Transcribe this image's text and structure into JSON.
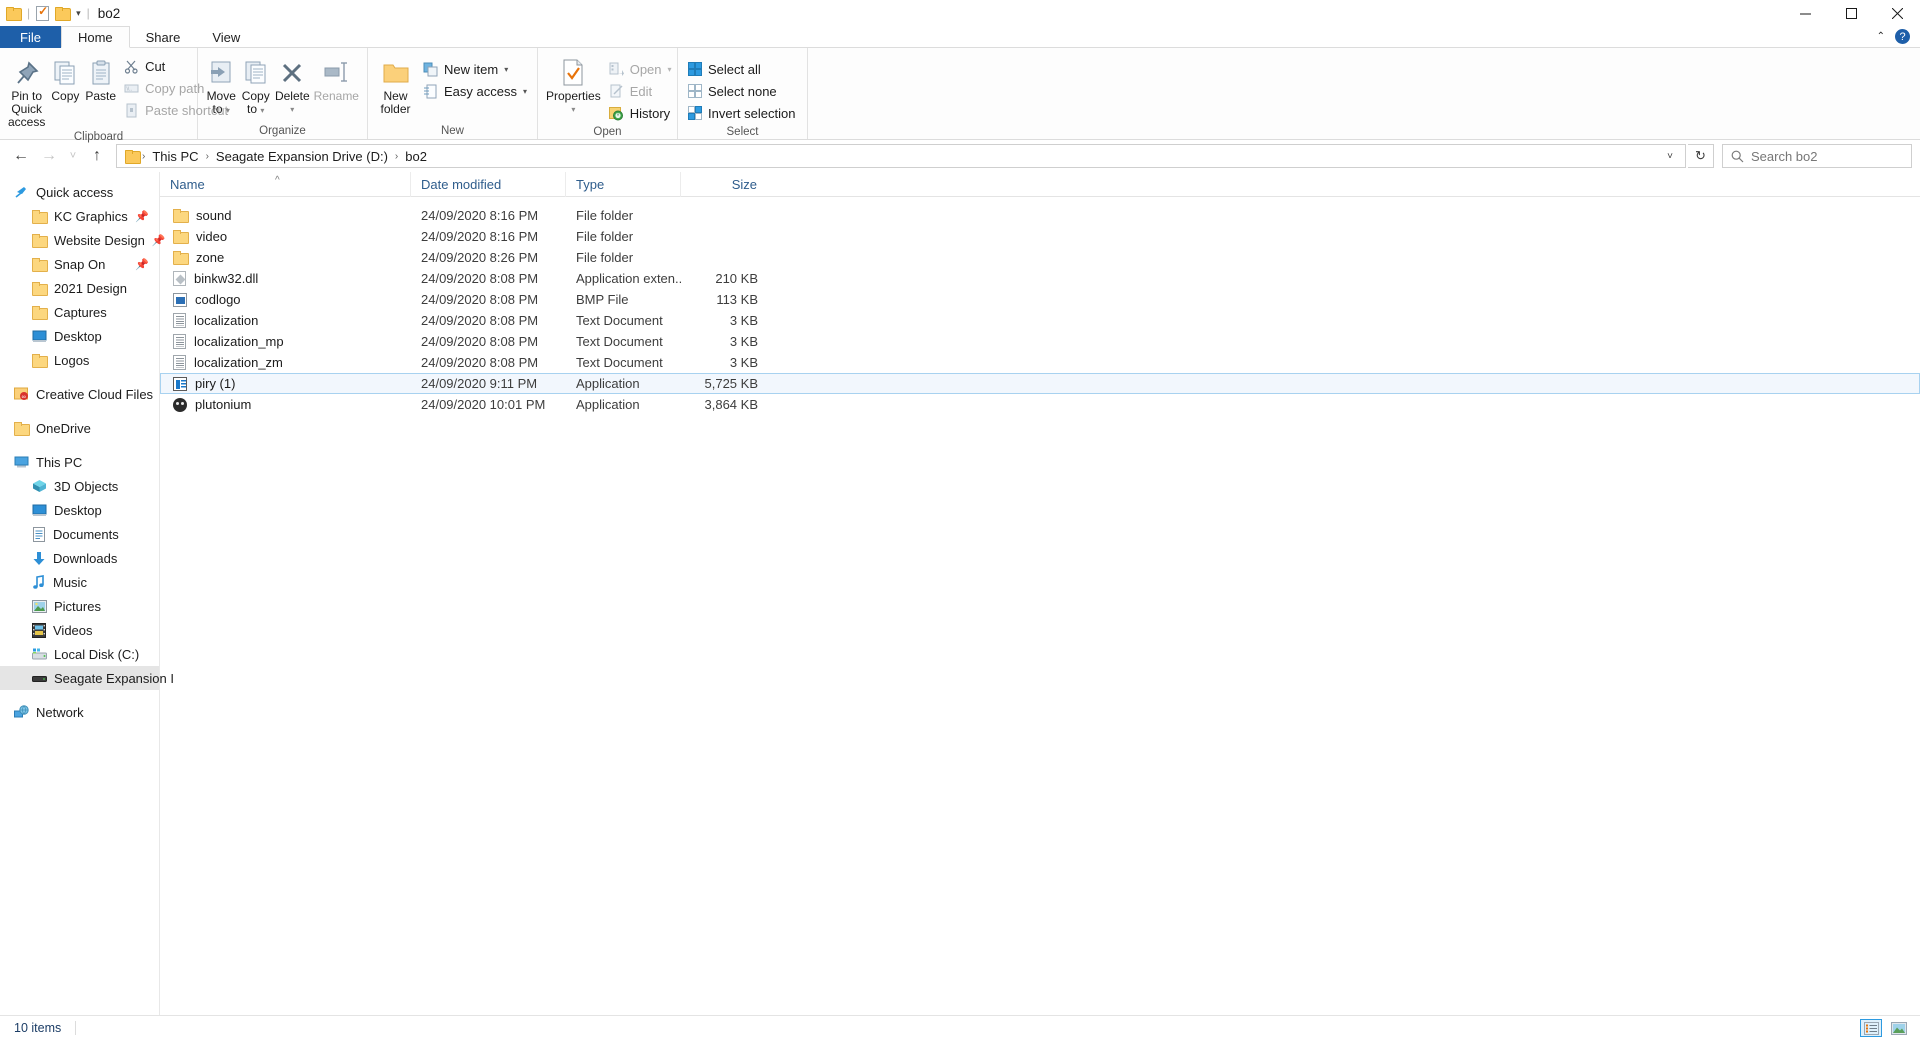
{
  "window": {
    "title": "bo2",
    "qat": [
      {
        "name": "qat-folder-icon",
        "icon": "folder-icon"
      },
      {
        "name": "qat-properties-icon",
        "icon": "properties-icon"
      },
      {
        "name": "qat-new-folder-icon",
        "icon": "folder-icon"
      }
    ],
    "buttons": {
      "minimize": "─",
      "maximize": "☐",
      "close": "✕"
    }
  },
  "tabs": [
    {
      "label": "File",
      "id": "file"
    },
    {
      "label": "Home",
      "id": "home"
    },
    {
      "label": "Share",
      "id": "share"
    },
    {
      "label": "View",
      "id": "view"
    }
  ],
  "tab_right": {
    "collapse": "⌃",
    "help": "?"
  },
  "ribbon": {
    "groups": [
      {
        "label": "Clipboard",
        "big": [
          {
            "label_line1": "Pin to Quick",
            "label_line2": "access",
            "icon": "pin-icon"
          },
          {
            "label_line1": "Copy",
            "label_line2": "",
            "icon": "copy-icon"
          },
          {
            "label_line1": "Paste",
            "label_line2": "",
            "icon": "paste-icon"
          }
        ],
        "small": [
          {
            "label": "Cut",
            "icon": "scissors-icon",
            "disabled": false
          },
          {
            "label": "Copy path",
            "icon": "copy-path-icon",
            "disabled": true
          },
          {
            "label": "Paste shortcut",
            "icon": "paste-shortcut-icon",
            "disabled": true
          }
        ]
      },
      {
        "label": "Organize",
        "big": [
          {
            "label_line1": "Move",
            "label_line2": "to",
            "icon": "move-to-icon",
            "dropdown": true
          },
          {
            "label_line1": "Copy",
            "label_line2": "to",
            "icon": "copy-to-icon",
            "dropdown": true
          },
          {
            "label_line1": "Delete",
            "label_line2": "",
            "icon": "delete-icon",
            "dropdown": true
          },
          {
            "label_line1": "Rename",
            "label_line2": "",
            "icon": "rename-icon"
          }
        ],
        "small": []
      },
      {
        "label": "New",
        "big": [
          {
            "label_line1": "New",
            "label_line2": "folder",
            "icon": "new-folder-icon"
          }
        ],
        "small": [
          {
            "label": "New item",
            "icon": "new-item-icon",
            "dropdown": true,
            "disabled": false
          },
          {
            "label": "Easy access",
            "icon": "easy-access-icon",
            "dropdown": true,
            "disabled": false
          }
        ]
      },
      {
        "label": "Open",
        "big": [
          {
            "label_line1": "Properties",
            "label_line2": "",
            "icon": "properties-icon",
            "dropdown": true
          }
        ],
        "small": [
          {
            "label": "Open",
            "icon": "open-icon",
            "dropdown": true,
            "disabled": true
          },
          {
            "label": "Edit",
            "icon": "edit-icon",
            "disabled": true
          },
          {
            "label": "History",
            "icon": "history-icon",
            "disabled": false
          }
        ]
      },
      {
        "label": "Select",
        "big": [],
        "small": [
          {
            "label": "Select all",
            "icon": "select-all-icon",
            "disabled": false
          },
          {
            "label": "Select none",
            "icon": "select-none-icon",
            "disabled": false
          },
          {
            "label": "Invert selection",
            "icon": "invert-selection-icon",
            "disabled": false
          }
        ]
      }
    ]
  },
  "addressbar": {
    "back": "←",
    "forward": "→",
    "recent": "˅",
    "up": "↑",
    "breadcrumbs": [
      "This PC",
      "Seagate Expansion Drive (D:)",
      "bo2"
    ],
    "separator": "›",
    "dropdown": "˅",
    "refresh": "↻",
    "search_placeholder": "Search bo2",
    "search_value": ""
  },
  "navpane": [
    {
      "label": "Quick access",
      "icon": "star-pin-icon",
      "level": "root",
      "pinned": false,
      "selected": false
    },
    {
      "label": "KC Graphics",
      "icon": "folder-icon",
      "level": "child",
      "pinned": true,
      "selected": false
    },
    {
      "label": "Website Design",
      "icon": "folder-icon",
      "level": "child",
      "pinned": true,
      "selected": false
    },
    {
      "label": "Snap On",
      "icon": "folder-icon",
      "level": "child",
      "pinned": true,
      "selected": false
    },
    {
      "label": "2021 Design",
      "icon": "folder-icon",
      "level": "child",
      "pinned": false,
      "selected": false
    },
    {
      "label": "Captures",
      "icon": "folder-icon",
      "level": "child",
      "pinned": false,
      "selected": false
    },
    {
      "label": "Desktop",
      "icon": "desktop-icon",
      "level": "child",
      "pinned": false,
      "selected": false
    },
    {
      "label": "Logos",
      "icon": "folder-icon",
      "level": "child",
      "pinned": false,
      "selected": false
    },
    {
      "label": "Creative Cloud Files",
      "icon": "creative-cloud-icon",
      "level": "root",
      "pinned": false,
      "selected": false,
      "spacer_before": true
    },
    {
      "label": "OneDrive",
      "icon": "onedrive-folder-icon",
      "level": "root",
      "pinned": false,
      "selected": false,
      "spacer_before": true
    },
    {
      "label": "This PC",
      "icon": "this-pc-icon",
      "level": "root",
      "pinned": false,
      "selected": false,
      "spacer_before": true
    },
    {
      "label": "3D Objects",
      "icon": "3d-objects-icon",
      "level": "child",
      "pinned": false,
      "selected": false
    },
    {
      "label": "Desktop",
      "icon": "desktop-icon",
      "level": "child",
      "pinned": false,
      "selected": false
    },
    {
      "label": "Documents",
      "icon": "documents-icon",
      "level": "child",
      "pinned": false,
      "selected": false
    },
    {
      "label": "Downloads",
      "icon": "downloads-icon",
      "level": "child",
      "pinned": false,
      "selected": false
    },
    {
      "label": "Music",
      "icon": "music-icon",
      "level": "child",
      "pinned": false,
      "selected": false
    },
    {
      "label": "Pictures",
      "icon": "pictures-icon",
      "level": "child",
      "pinned": false,
      "selected": false
    },
    {
      "label": "Videos",
      "icon": "videos-icon",
      "level": "child",
      "pinned": false,
      "selected": false
    },
    {
      "label": "Local Disk (C:)",
      "icon": "drive-icon",
      "level": "child",
      "pinned": false,
      "selected": false
    },
    {
      "label": "Seagate Expansion I",
      "icon": "external-drive-icon",
      "level": "child",
      "pinned": false,
      "selected": true
    },
    {
      "label": "Network",
      "icon": "network-icon",
      "level": "root",
      "pinned": false,
      "selected": false,
      "spacer_before": true
    }
  ],
  "filelist": {
    "columns": [
      {
        "label": "Name",
        "key": "name"
      },
      {
        "label": "Date modified",
        "key": "date"
      },
      {
        "label": "Type",
        "key": "type"
      },
      {
        "label": "Size",
        "key": "size"
      }
    ],
    "sort_column": "Name",
    "sort_direction": "ascending",
    "rows": [
      {
        "name": "sound",
        "date": "24/09/2020 8:16 PM",
        "type": "File folder",
        "size": "",
        "icon": "folder-icon",
        "selected": false
      },
      {
        "name": "video",
        "date": "24/09/2020 8:16 PM",
        "type": "File folder",
        "size": "",
        "icon": "folder-icon",
        "selected": false
      },
      {
        "name": "zone",
        "date": "24/09/2020 8:26 PM",
        "type": "File folder",
        "size": "",
        "icon": "folder-icon",
        "selected": false
      },
      {
        "name": "binkw32.dll",
        "date": "24/09/2020 8:08 PM",
        "type": "Application exten...",
        "size": "210 KB",
        "icon": "dll-icon",
        "selected": false
      },
      {
        "name": "codlogo",
        "date": "24/09/2020 8:08 PM",
        "type": "BMP File",
        "size": "113 KB",
        "icon": "bmp-icon",
        "selected": false
      },
      {
        "name": "localization",
        "date": "24/09/2020 8:08 PM",
        "type": "Text Document",
        "size": "3 KB",
        "icon": "text-document-icon",
        "selected": false
      },
      {
        "name": "localization_mp",
        "date": "24/09/2020 8:08 PM",
        "type": "Text Document",
        "size": "3 KB",
        "icon": "text-document-icon",
        "selected": false
      },
      {
        "name": "localization_zm",
        "date": "24/09/2020 8:08 PM",
        "type": "Text Document",
        "size": "3 KB",
        "icon": "text-document-icon",
        "selected": false
      },
      {
        "name": "piry (1)",
        "date": "24/09/2020 9:11 PM",
        "type": "Application",
        "size": "5,725 KB",
        "icon": "application-icon",
        "selected": true
      },
      {
        "name": "plutonium",
        "date": "24/09/2020 10:01 PM",
        "type": "Application",
        "size": "3,864 KB",
        "icon": "plutonium-skull-icon",
        "selected": false
      }
    ]
  },
  "statusbar": {
    "item_count": "10 items",
    "views": [
      {
        "name": "details-view-button",
        "active": true
      },
      {
        "name": "large-icons-view-button",
        "active": false
      }
    ]
  },
  "colors": {
    "accent": "#1e5fa9",
    "selection_fill": "#f2f7fd",
    "selection_border": "#a8d2f0",
    "nav_selected": "#e5e5e5",
    "header_text": "#2f5d8c"
  }
}
